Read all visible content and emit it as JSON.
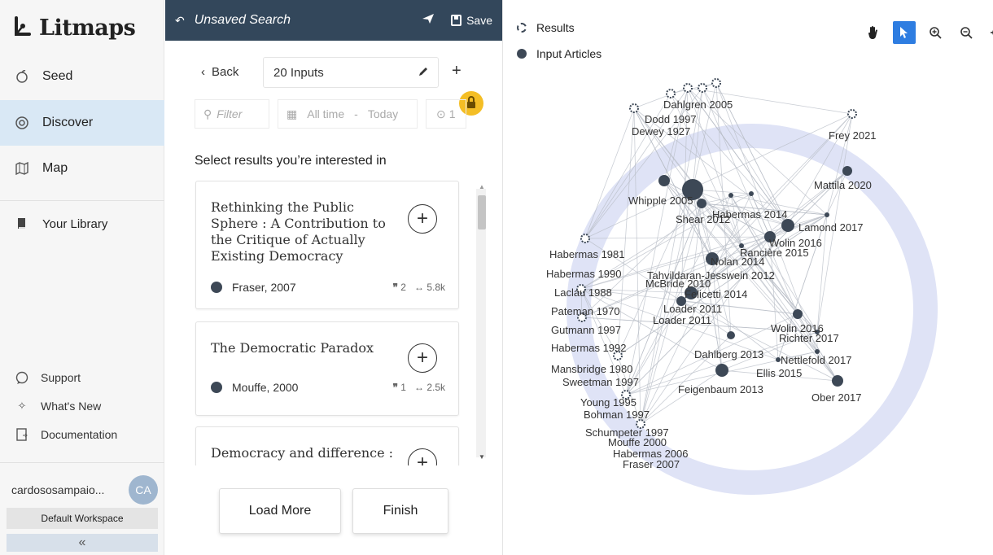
{
  "app": {
    "name": "Litmaps"
  },
  "sidebar": {
    "nav": [
      {
        "label": "Seed",
        "icon": "seed-icon"
      },
      {
        "label": "Discover",
        "icon": "discover-icon"
      },
      {
        "label": "Map",
        "icon": "map-icon"
      },
      {
        "label": "Your Library",
        "icon": "library-icon"
      }
    ],
    "links": [
      {
        "label": "Support",
        "icon": "support-icon"
      },
      {
        "label": "What's New",
        "icon": "whats-new-icon"
      },
      {
        "label": "Documentation",
        "icon": "documentation-icon"
      }
    ],
    "user": {
      "name": "cardososampaio...",
      "initials": "CA"
    },
    "workspace": "Default Workspace",
    "collapse_glyph": "«"
  },
  "panel": {
    "header": {
      "title": "Unsaved Search",
      "save_label": "Save"
    },
    "back_label": "Back",
    "inputs_label": "20 Inputs",
    "filter_placeholder": "Filter",
    "date_range": {
      "from": "All time",
      "separator": "-",
      "to": "Today"
    },
    "extra_filter": "1",
    "select_label": "Select results you’re interested in",
    "results": [
      {
        "title": "Rethinking the Public Sphere : A Contribution to the Critique of Actually Existing Democracy",
        "author": "Fraser, 2007",
        "quotes": "2",
        "refs": "5.8k"
      },
      {
        "title": "The Democratic Paradox",
        "author": "Mouffe, 2000",
        "quotes": "1",
        "refs": "2.5k"
      },
      {
        "title": "Democracy and difference :",
        "author": "",
        "quotes": "",
        "refs": ""
      }
    ],
    "buttons": {
      "load_more": "Load More",
      "finish": "Finish"
    }
  },
  "graph": {
    "legend": {
      "results": "Results",
      "inputs": "Input Articles"
    },
    "labels": [
      "Dahlgren 2005",
      "Dodd 1997",
      "Dewey 1927",
      "Frey 2021",
      "Mattila 2020",
      "Whipple 2005",
      "Shear 2012",
      "Habermas 2014",
      "Lamond 2017",
      "Wolin 2016",
      "Habermas 1981",
      "Rancière 2015",
      "Nolan 2014",
      "Habermas 1990",
      "Tahvildaran-Jesswein 2012",
      "McBride 2010",
      "Laclau 1988",
      "Felicetti 2014",
      "Pateman 1970",
      "Loader 2011",
      "Loader 2011",
      "Gutmann 1997",
      "Wolin 2016",
      "Richter 2017",
      "Habermas 1992",
      "Dahlberg 2013",
      "Nettlefold 2017",
      "Mansbridge 1980",
      "Ellis 2015",
      "Sweetman 1997",
      "Feigenbaum 2013",
      "Ober 2017",
      "Young 1995",
      "Bohman 1997",
      "Schumpeter 1997",
      "Mouffe 2000",
      "Habermas 2006",
      "Fraser 2007"
    ]
  }
}
